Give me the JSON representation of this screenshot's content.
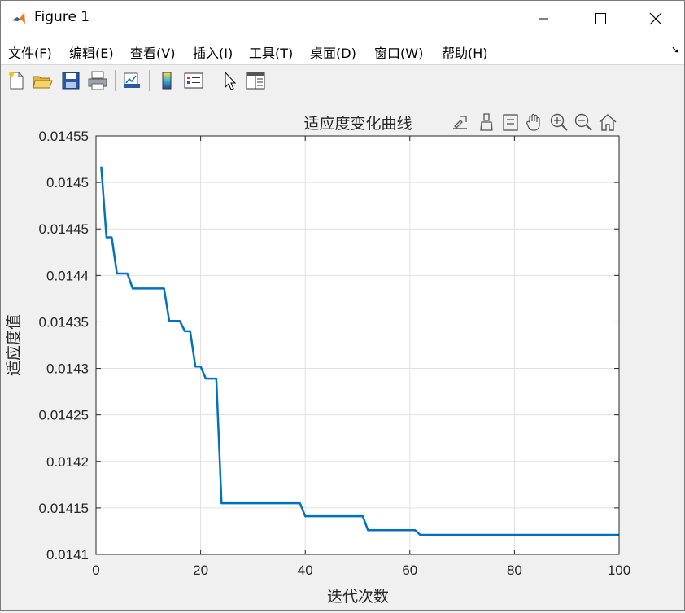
{
  "window": {
    "title": "Figure 1"
  },
  "menu": {
    "items": [
      "文件(F)",
      "编辑(E)",
      "查看(V)",
      "插入(I)",
      "工具(T)",
      "桌面(D)",
      "窗口(W)",
      "帮助(H)"
    ]
  },
  "toolbar": {
    "buttons": [
      "new-figure-icon",
      "open-file-icon",
      "save-icon",
      "print-icon",
      "link-plot-icon",
      "insert-colorbar-icon",
      "insert-legend-icon",
      "edit-plot-icon",
      "property-inspector-icon"
    ]
  },
  "axes_toolbar": {
    "buttons": [
      "export-icon",
      "brush-icon",
      "data-tips-icon",
      "pan-icon",
      "zoom-in-icon",
      "zoom-out-icon",
      "home-icon"
    ]
  },
  "colors": {
    "line": "#0072BD",
    "grid": "#e0e0e0",
    "axes": "#262626"
  },
  "chart_data": {
    "type": "line",
    "title": "适应度变化曲线",
    "xlabel": "迭代次数",
    "ylabel": "适应度值",
    "xlim": [
      0,
      100
    ],
    "ylim": [
      0.0141,
      0.01455
    ],
    "xticks": [
      0,
      20,
      40,
      60,
      80,
      100
    ],
    "xtick_labels": [
      "0",
      "20",
      "40",
      "60",
      "80",
      "100"
    ],
    "yticks": [
      0.0141,
      0.01415,
      0.0142,
      0.01425,
      0.0143,
      0.01435,
      0.0144,
      0.01445,
      0.0145,
      0.01455
    ],
    "ytick_labels": [
      "0.0141",
      "0.01415",
      "0.0142",
      "0.01425",
      "0.0143",
      "0.01435",
      "0.0144",
      "0.01445",
      "0.0145",
      "0.01455"
    ],
    "grid": true,
    "series": [
      {
        "x": [
          1,
          2,
          3,
          4,
          5,
          6,
          7,
          8,
          9,
          10,
          11,
          12,
          13,
          14,
          15,
          16,
          17,
          18,
          19,
          20,
          21,
          22,
          23,
          24,
          25,
          26,
          27,
          28,
          29,
          30,
          31,
          32,
          33,
          34,
          35,
          36,
          37,
          38,
          39,
          40,
          41,
          42,
          43,
          44,
          45,
          46,
          47,
          48,
          49,
          50,
          51,
          52,
          53,
          54,
          55,
          56,
          57,
          58,
          59,
          60,
          61,
          62,
          63,
          64,
          65,
          66,
          67,
          68,
          69,
          70,
          71,
          72,
          73,
          74,
          75,
          76,
          77,
          78,
          79,
          80,
          81,
          82,
          83,
          84,
          85,
          86,
          87,
          88,
          89,
          90,
          91,
          92,
          93,
          94,
          95,
          96,
          97,
          98,
          99,
          100
        ],
        "y": [
          0.014517,
          0.014441,
          0.014441,
          0.014402,
          0.014402,
          0.014402,
          0.014386,
          0.014386,
          0.014386,
          0.014386,
          0.014386,
          0.014386,
          0.014386,
          0.014351,
          0.014351,
          0.014351,
          0.01434,
          0.01434,
          0.014302,
          0.014302,
          0.014289,
          0.014289,
          0.014289,
          0.014155,
          0.014155,
          0.014155,
          0.014155,
          0.014155,
          0.014155,
          0.014155,
          0.014155,
          0.014155,
          0.014155,
          0.014155,
          0.014155,
          0.014155,
          0.014155,
          0.014155,
          0.014155,
          0.014141,
          0.014141,
          0.014141,
          0.014141,
          0.014141,
          0.014141,
          0.014141,
          0.014141,
          0.014141,
          0.014141,
          0.014141,
          0.014141,
          0.014126,
          0.014126,
          0.014126,
          0.014126,
          0.014126,
          0.014126,
          0.014126,
          0.014126,
          0.014126,
          0.014126,
          0.014121,
          0.014121,
          0.014121,
          0.014121,
          0.014121,
          0.014121,
          0.014121,
          0.014121,
          0.014121,
          0.014121,
          0.014121,
          0.014121,
          0.014121,
          0.014121,
          0.014121,
          0.014121,
          0.014121,
          0.014121,
          0.014121,
          0.014121,
          0.014121,
          0.014121,
          0.014121,
          0.014121,
          0.014121,
          0.014121,
          0.014121,
          0.014121,
          0.014121,
          0.014121,
          0.014121,
          0.014121,
          0.014121,
          0.014121,
          0.014121,
          0.014121,
          0.014121,
          0.014121,
          0.014121
        ]
      }
    ]
  }
}
